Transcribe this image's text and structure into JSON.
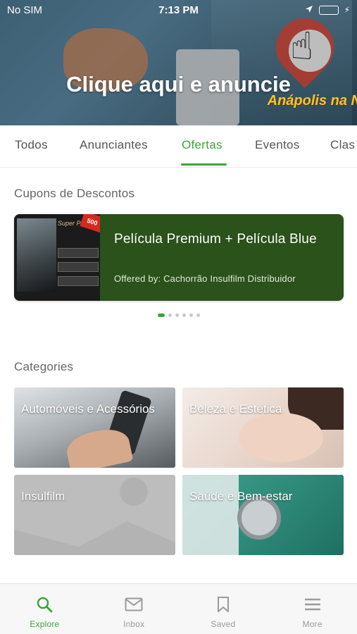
{
  "status_bar": {
    "carrier": "No SIM",
    "time": "7:13 PM",
    "battery_color": "#4cd964"
  },
  "hero": {
    "title": "Clique aqui e anuncie",
    "subtitle": "Anápolis na N"
  },
  "tabs": [
    {
      "label": "Todos",
      "active": false
    },
    {
      "label": "Anunciantes",
      "active": false
    },
    {
      "label": "Ofertas",
      "active": true
    },
    {
      "label": "Eventos",
      "active": false
    },
    {
      "label": "Clas",
      "active": false
    }
  ],
  "coupons": {
    "section_title": "Cupons de Descontos",
    "card": {
      "title": "Película Premium + Película Blue",
      "subtitle": "Offered by: Cachorrão Insulfilm Distribuidor",
      "thumbnail_badge": "500"
    },
    "pager": {
      "count": 6,
      "active_index": 0
    }
  },
  "categories": {
    "section_title": "Categories",
    "items": [
      {
        "label": "Automóveis e Acessórios"
      },
      {
        "label": "Beleza e Estética"
      },
      {
        "label": "Insulfilm"
      },
      {
        "label": "Saúde e Bem-estar"
      }
    ]
  },
  "bottom_nav": [
    {
      "label": "Explore",
      "icon": "search-icon",
      "active": true
    },
    {
      "label": "Inbox",
      "icon": "envelope-icon",
      "active": false
    },
    {
      "label": "Saved",
      "icon": "bookmark-icon",
      "active": false
    },
    {
      "label": "More",
      "icon": "menu-icon",
      "active": false
    }
  ],
  "colors": {
    "accent": "#3aa53a",
    "coupon_bg": "#2a521a",
    "inactive": "#9a9a9a"
  }
}
